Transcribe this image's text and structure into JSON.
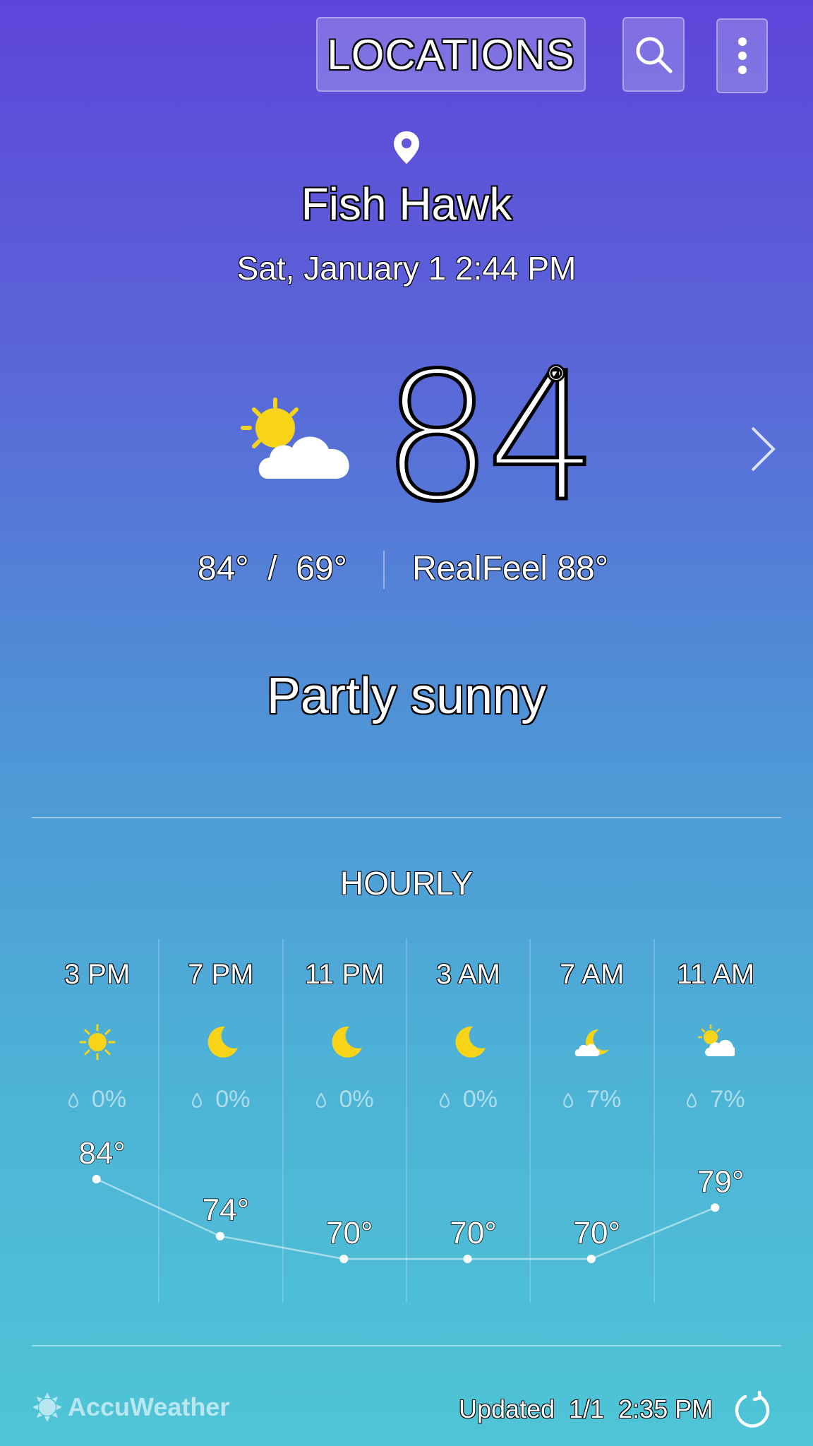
{
  "header": {
    "locations_label": "LOCATIONS",
    "search_icon": "search-icon",
    "more_icon": "more-vert-icon"
  },
  "location": {
    "city": "Fish Hawk",
    "datetime": "Sat, January 1 2:44 PM"
  },
  "current": {
    "icon": "partly-sunny-icon",
    "temp": "84",
    "degree": "°",
    "hi_lo": "84°  /  69°",
    "realfeel": "RealFeel 88°",
    "condition": "Partly sunny"
  },
  "hourly": {
    "title": "HOURLY",
    "items": [
      {
        "time": "3 PM",
        "icon": "sun-icon",
        "precip": "0%",
        "temp": "84°",
        "temp_value": 84
      },
      {
        "time": "7 PM",
        "icon": "moon-icon",
        "precip": "0%",
        "temp": "74°",
        "temp_value": 74
      },
      {
        "time": "11 PM",
        "icon": "moon-icon",
        "precip": "0%",
        "temp": "70°",
        "temp_value": 70
      },
      {
        "time": "3 AM",
        "icon": "moon-icon",
        "precip": "0%",
        "temp": "70°",
        "temp_value": 70
      },
      {
        "time": "7 AM",
        "icon": "partly-cloudy-night-icon",
        "precip": "7%",
        "temp": "70°",
        "temp_value": 70
      },
      {
        "time": "11 AM",
        "icon": "partly-sunny-icon",
        "precip": "7%",
        "temp": "79°",
        "temp_value": 79
      }
    ]
  },
  "footer": {
    "brand": "AccuWeather",
    "updated": "Updated  1/1  2:35 PM"
  },
  "colors": {
    "sun": "#f7d417",
    "background_top": "#5e45da",
    "background_bottom": "#4fc5d6"
  }
}
